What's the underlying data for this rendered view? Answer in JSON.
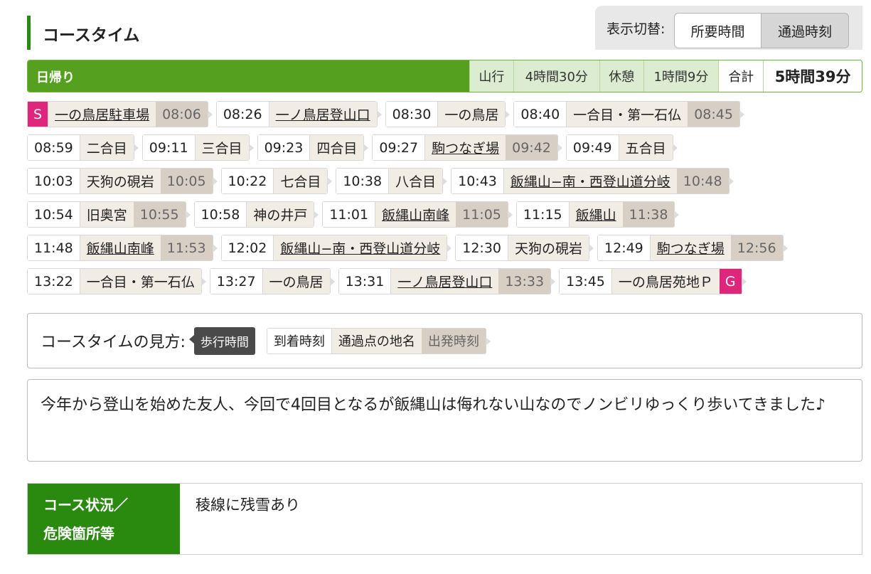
{
  "header": {
    "title": "コースタイム",
    "toggle_label": "表示切替:",
    "toggle_options": [
      "所要時間",
      "通過時刻"
    ],
    "toggle_selected": "通過時刻"
  },
  "summary": {
    "type": "日帰り",
    "walk_label": "山行",
    "walk_time": "4時間30分",
    "rest_label": "休憩",
    "rest_time": "1時間9分",
    "total_label": "合計",
    "total_time": "5時間39分"
  },
  "rows": [
    [
      {
        "mark": "S",
        "name": "一の鳥居駐車場",
        "link": true,
        "dep": "08:06"
      },
      {
        "arr": "08:26",
        "name": "一ノ鳥居登山口",
        "link": true
      },
      {
        "arr": "08:30",
        "name": "一の鳥居",
        "link": false
      },
      {
        "arr": "08:40",
        "name": "一合目・第一石仏",
        "link": false,
        "dep": "08:45"
      }
    ],
    [
      {
        "arr": "08:59",
        "name": "二合目",
        "link": false
      },
      {
        "arr": "09:11",
        "name": "三合目",
        "link": false
      },
      {
        "arr": "09:23",
        "name": "四合目",
        "link": false
      },
      {
        "arr": "09:27",
        "name": "駒つなぎ場",
        "link": true,
        "dep": "09:42"
      },
      {
        "arr": "09:49",
        "name": "五合目",
        "link": false
      }
    ],
    [
      {
        "arr": "10:03",
        "name": "天狗の硯岩",
        "link": false,
        "dep": "10:05"
      },
      {
        "arr": "10:22",
        "name": "七合目",
        "link": false
      },
      {
        "arr": "10:38",
        "name": "八合目",
        "link": false
      },
      {
        "arr": "10:43",
        "name": "飯縄山−南・西登山道分岐",
        "link": true,
        "dep": "10:48"
      }
    ],
    [
      {
        "arr": "10:54",
        "name": "旧奥宮",
        "link": false,
        "dep": "10:55"
      },
      {
        "arr": "10:58",
        "name": "神の井戸",
        "link": false
      },
      {
        "arr": "11:01",
        "name": "飯縄山南峰",
        "link": true,
        "dep": "11:05"
      },
      {
        "arr": "11:15",
        "name": "飯縄山",
        "link": true,
        "dep": "11:38"
      }
    ],
    [
      {
        "arr": "11:48",
        "name": "飯縄山南峰",
        "link": true,
        "dep": "11:53"
      },
      {
        "arr": "12:02",
        "name": "飯縄山−南・西登山道分岐",
        "link": true
      },
      {
        "arr": "12:30",
        "name": "天狗の硯岩",
        "link": false
      },
      {
        "arr": "12:49",
        "name": "駒つなぎ場",
        "link": true,
        "dep": "12:56"
      }
    ],
    [
      {
        "arr": "13:22",
        "name": "一合目・第一石仏",
        "link": false
      },
      {
        "arr": "13:27",
        "name": "一の鳥居",
        "link": false
      },
      {
        "arr": "13:31",
        "name": "一ノ鳥居登山口",
        "link": true,
        "dep": "13:33"
      },
      {
        "arr": "13:45",
        "name": "一の鳥居苑地Ｐ",
        "link": false,
        "mark": "G"
      }
    ]
  ],
  "legend": {
    "label": "コースタイムの見方:",
    "walk": "歩行時間",
    "arr": "到着時刻",
    "name": "通過点の地名",
    "dep": "出発時刻"
  },
  "comment": "今年から登山を始めた友人、今回で4回目となるが飯縄山は侮れない山なのでノンビリゆっくり歩いてきました♪",
  "status": {
    "heading_line1": "コース状況／",
    "heading_line2": "危険箇所等",
    "text": "稜線に残雪あり"
  },
  "colors": {
    "green": "#56a01f",
    "dark_green": "#2a8a10",
    "marker_pink": "#e0257d"
  }
}
